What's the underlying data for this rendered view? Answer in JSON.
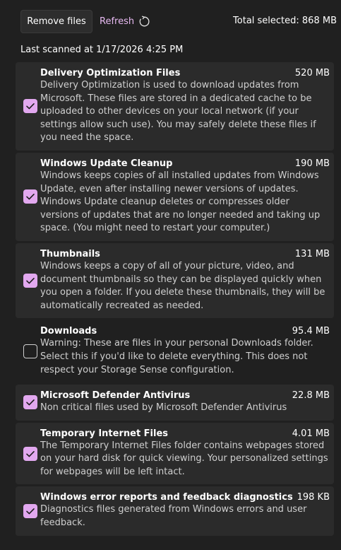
{
  "toolbar": {
    "remove_label": "Remove files",
    "refresh_label": "Refresh",
    "total_selected": "Total selected: 868 MB"
  },
  "last_scanned": "Last scanned at 1/17/2026 4:25 PM",
  "colors": {
    "accent": "#e2a8ef",
    "background": "#202020",
    "card": "#2b2b2b"
  },
  "items": [
    {
      "title": "Delivery Optimization Files",
      "size": "520 MB",
      "checked": true,
      "description": "Delivery Optimization is used to download updates from Microsoft. These files are stored in a dedicated cache to be uploaded to other devices on your local network (if your settings allow such use). You may safely delete these files if you need the space."
    },
    {
      "title": "Windows Update Cleanup",
      "size": "190 MB",
      "checked": true,
      "description": "Windows keeps copies of all installed updates from Windows Update, even after installing newer versions of updates. Windows Update cleanup deletes or compresses older versions of updates that are no longer needed and taking up space. (You might need to restart your computer.)"
    },
    {
      "title": "Thumbnails",
      "size": "131 MB",
      "checked": true,
      "description": "Windows keeps a copy of all of your picture, video, and document thumbnails so they can be displayed quickly when you open a folder. If you delete these thumbnails, they will be automatically recreated as needed."
    },
    {
      "title": "Downloads",
      "size": "95.4 MB",
      "checked": false,
      "description": "Warning: These are files in your personal Downloads folder. Select this if you'd like to delete everything. This does not respect your Storage Sense configuration."
    },
    {
      "title": "Microsoft Defender Antivirus",
      "size": "22.8 MB",
      "checked": true,
      "description": "Non critical files used by Microsoft Defender Antivirus"
    },
    {
      "title": "Temporary Internet Files",
      "size": "4.01 MB",
      "checked": true,
      "description": "The Temporary Internet Files folder contains webpages stored on your hard disk for quick viewing. Your personalized settings for webpages will be left intact."
    },
    {
      "title": "Windows error reports and feedback diagnostics",
      "size": "198 KB",
      "checked": true,
      "description": "Diagnostics files generated from Windows errors and user feedback."
    }
  ]
}
